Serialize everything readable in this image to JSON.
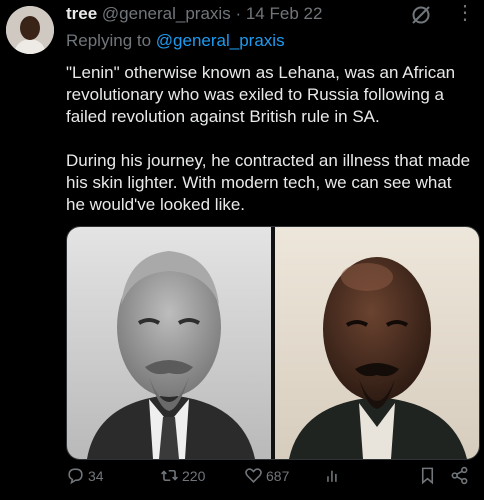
{
  "tweet": {
    "display_name": "tree",
    "handle": "@general_praxis",
    "separator": "·",
    "date": "14 Feb 22",
    "replying_prefix": "Replying to",
    "replying_handle": "@general_praxis",
    "paragraphs": [
      "\"Lenin\" otherwise known as Lehana, was an African revolutionary who was exiled to Russia following a failed revolution against British rule in SA.",
      "During his journey, he contracted an illness that made his skin lighter. With modern tech, we can see what he would've looked like."
    ]
  },
  "actions": {
    "replies": "34",
    "retweets": "220",
    "likes": "687"
  },
  "icons": {
    "avatar": "avatar",
    "grok": "grok-icon",
    "more": "more-icon",
    "reply": "reply-icon",
    "retweet": "retweet-icon",
    "like": "heart-icon",
    "views": "views-icon",
    "bookmark": "bookmark-icon",
    "share": "share-icon"
  },
  "colors": {
    "background": "#000000",
    "text": "#e7e9ea",
    "secondary": "#71767b",
    "link": "#1d9bf0"
  }
}
